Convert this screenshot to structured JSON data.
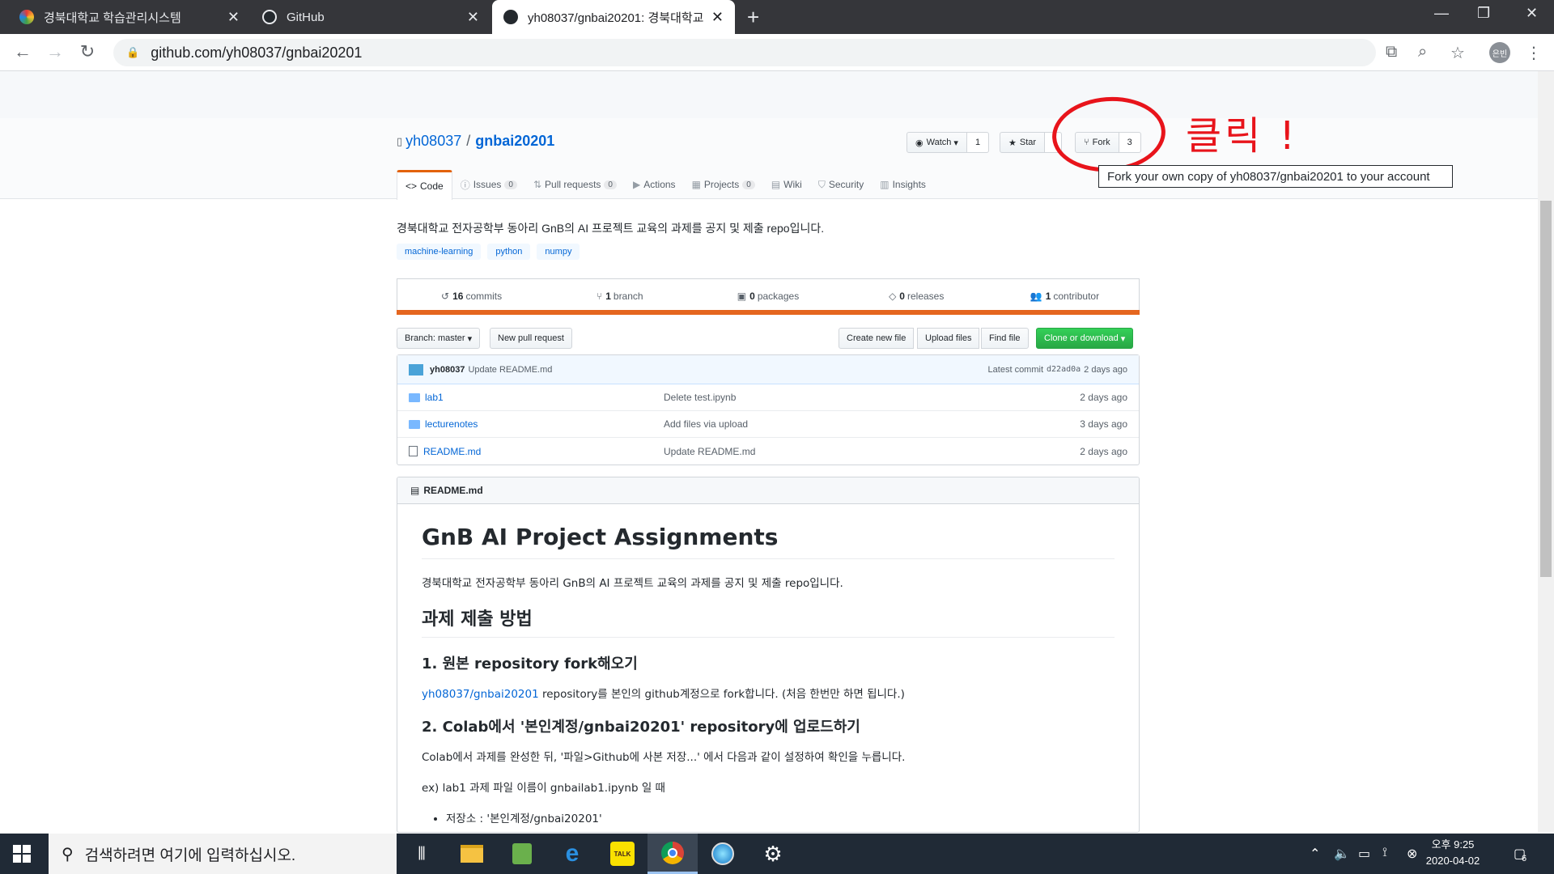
{
  "browser": {
    "tabs": [
      {
        "title": "경북대학교 학습관리시스템",
        "favicon_color": "#d04a2a",
        "active": false
      },
      {
        "title": "GitHub",
        "favicon_color": "#24292e",
        "active": false
      },
      {
        "title": "yh08037/gnbai20201: 경북대학교",
        "favicon_color": "#24292e",
        "active": true
      }
    ],
    "new_tab": "+",
    "url": "github.com/yh08037/gnbai20201",
    "profile_initials": "은빈"
  },
  "repo": {
    "owner": "yh08037",
    "name": "gnbai20201",
    "separator": "/",
    "watch_label": "Watch",
    "watch_count": "1",
    "star_label": "Star",
    "star_count": "",
    "fork_label": "Fork",
    "fork_count": "3",
    "fork_tooltip": "Fork your own copy of yh08037/gnbai20201 to your account",
    "tabs": [
      {
        "label": "Code",
        "icon": "code-icon",
        "count": ""
      },
      {
        "label": "Issues",
        "icon": "issue-icon",
        "count": "0"
      },
      {
        "label": "Pull requests",
        "icon": "pr-icon",
        "count": "0"
      },
      {
        "label": "Actions",
        "icon": "play-icon",
        "count": ""
      },
      {
        "label": "Projects",
        "icon": "project-icon",
        "count": "0"
      },
      {
        "label": "Wiki",
        "icon": "book-icon",
        "count": ""
      },
      {
        "label": "Security",
        "icon": "shield-icon",
        "count": ""
      },
      {
        "label": "Insights",
        "icon": "graph-icon",
        "count": ""
      }
    ],
    "description": "경북대학교 전자공학부 동아리 GnB의 AI 프로젝트 교육의 과제를 공지 및 제출 repo입니다.",
    "topics": [
      "machine-learning",
      "python",
      "numpy"
    ],
    "summary": [
      {
        "num": "16",
        "label": "commits"
      },
      {
        "num": "1",
        "label": "branch"
      },
      {
        "num": "0",
        "label": "packages"
      },
      {
        "num": "0",
        "label": "releases"
      },
      {
        "num": "1",
        "label": "contributor"
      }
    ],
    "language_color": "#e5661f",
    "branch_label": "Branch: master",
    "new_pr": "New pull request",
    "create_file": "Create new file",
    "upload_files": "Upload files",
    "find_file": "Find file",
    "clone": "Clone or download",
    "latest": {
      "author": "yh08037",
      "message": "Update README.md",
      "latest_label": "Latest commit",
      "sha": "d22ad0a",
      "time": "2 days ago"
    },
    "files": [
      {
        "name": "lab1",
        "type": "dir",
        "message": "Delete test.ipynb",
        "age": "2 days ago"
      },
      {
        "name": "lecturenotes",
        "type": "dir",
        "message": "Add files via upload",
        "age": "3 days ago"
      },
      {
        "name": "README.md",
        "type": "file",
        "message": "Update README.md",
        "age": "2 days ago"
      }
    ]
  },
  "readme": {
    "header": "README.md",
    "h1": "GnB AI Project Assignments",
    "intro": "경북대학교 전자공학부 동아리 GnB의 AI 프로젝트 교육의 과제를 공지 및 제출 repo입니다.",
    "h2": "과제 제출 방법",
    "step1_title": "1. 원본 repository fork해오기",
    "step1_link": "yh08037/gnbai20201",
    "step1_text": " repository를 본인의 github계정으로 fork합니다. (처음 한번만 하면 됩니다.)",
    "step2_title": "2. Colab에서 '본인계정/gnbai20201' repository에 업로드하기",
    "step2_text": "Colab에서 과제를 완성한 뒤, '파일>Github에 사본 저장...' 에서 다음과 같이 설정하여 확인을 누릅니다.",
    "example": "ex) lab1 과제 파일 이름이 gnbailab1.ipynb 일 때",
    "bullet": "저장소 : '본인계정/gnbai20201'"
  },
  "annotation": {
    "text": "클릭 !",
    "color": "#e8141b"
  },
  "taskbar": {
    "search_placeholder": "검색하려면 여기에 입력하십시오.",
    "time": "오후 9:25",
    "date": "2020-04-02",
    "notifications": "6"
  }
}
